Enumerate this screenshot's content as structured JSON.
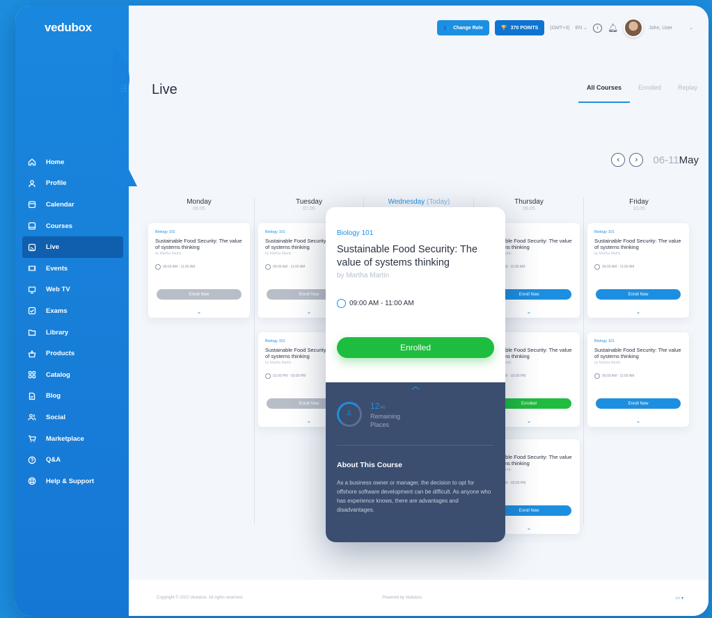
{
  "app": {
    "logo": "vedubox"
  },
  "topbar": {
    "change_role": "Change Role",
    "points": "370 POINTS",
    "timezone": "(GMT+3)",
    "language": "EN",
    "user_name": "John, User"
  },
  "sidebar": {
    "items": [
      {
        "label": "Home",
        "icon": "home-icon"
      },
      {
        "label": "Profile",
        "icon": "user-icon"
      },
      {
        "label": "Calendar",
        "icon": "calendar-icon"
      },
      {
        "label": "Courses",
        "icon": "courses-icon"
      },
      {
        "label": "Live",
        "icon": "live-icon",
        "active": true
      },
      {
        "label": "Events",
        "icon": "ticket-icon"
      },
      {
        "label": "Web TV",
        "icon": "tv-icon"
      },
      {
        "label": "Exams",
        "icon": "exam-icon"
      },
      {
        "label": "Library",
        "icon": "folder-icon"
      },
      {
        "label": "Products",
        "icon": "basket-icon"
      },
      {
        "label": "Catalog",
        "icon": "grid-icon"
      },
      {
        "label": "Blog",
        "icon": "document-icon"
      },
      {
        "label": "Social",
        "icon": "people-icon"
      },
      {
        "label": "Marketplace",
        "icon": "cart-icon"
      },
      {
        "label": "Q&A",
        "icon": "question-icon"
      },
      {
        "label": "Help & Support",
        "icon": "lifebuoy-icon"
      }
    ]
  },
  "page": {
    "title": "Live",
    "tabs": [
      "All Courses",
      "Enrolled",
      "Replay"
    ],
    "date_range_prefix": "06-11",
    "date_range_month": "May"
  },
  "days": [
    {
      "name": "Monday",
      "date": "06.05"
    },
    {
      "name": "Tuesday",
      "date": "07.05"
    },
    {
      "name": "Wednesday",
      "today": "(Today)",
      "date": ""
    },
    {
      "name": "Thursday",
      "date": "09.05"
    },
    {
      "name": "Friday",
      "date": "10.05"
    }
  ],
  "card": {
    "category": "Biology 101",
    "title": "Sustainable Food Security: The value of systems thinking",
    "author": "by Martha Martin",
    "time": "09:00 AM - 11:00 AM",
    "time_pm": "01:00 PM - 03:00 PM",
    "enroll": "Enroll Now",
    "enrolled": "Enrolled"
  },
  "popup": {
    "category": "Biology 101",
    "title": "Sustainable Food Security: The value of systems thinking",
    "author": "by Martha Martin",
    "time": "09:00 AM - 11:00 AM",
    "button": "Enrolled",
    "remaining_count": "12",
    "remaining_total": "/40",
    "remaining_label": "Remaining Places",
    "about_heading": "About This Course",
    "about_text": "As a business owner or manager, the decision to opt for offshore software development can be difficult. As anyone who has experience knows, there are advantages and disadvantages."
  },
  "footer": {
    "copyright": "Copyright © 2022 Vedubox. All rights reserved.",
    "powered": "Powered by Vedubox.",
    "lang": "en"
  }
}
